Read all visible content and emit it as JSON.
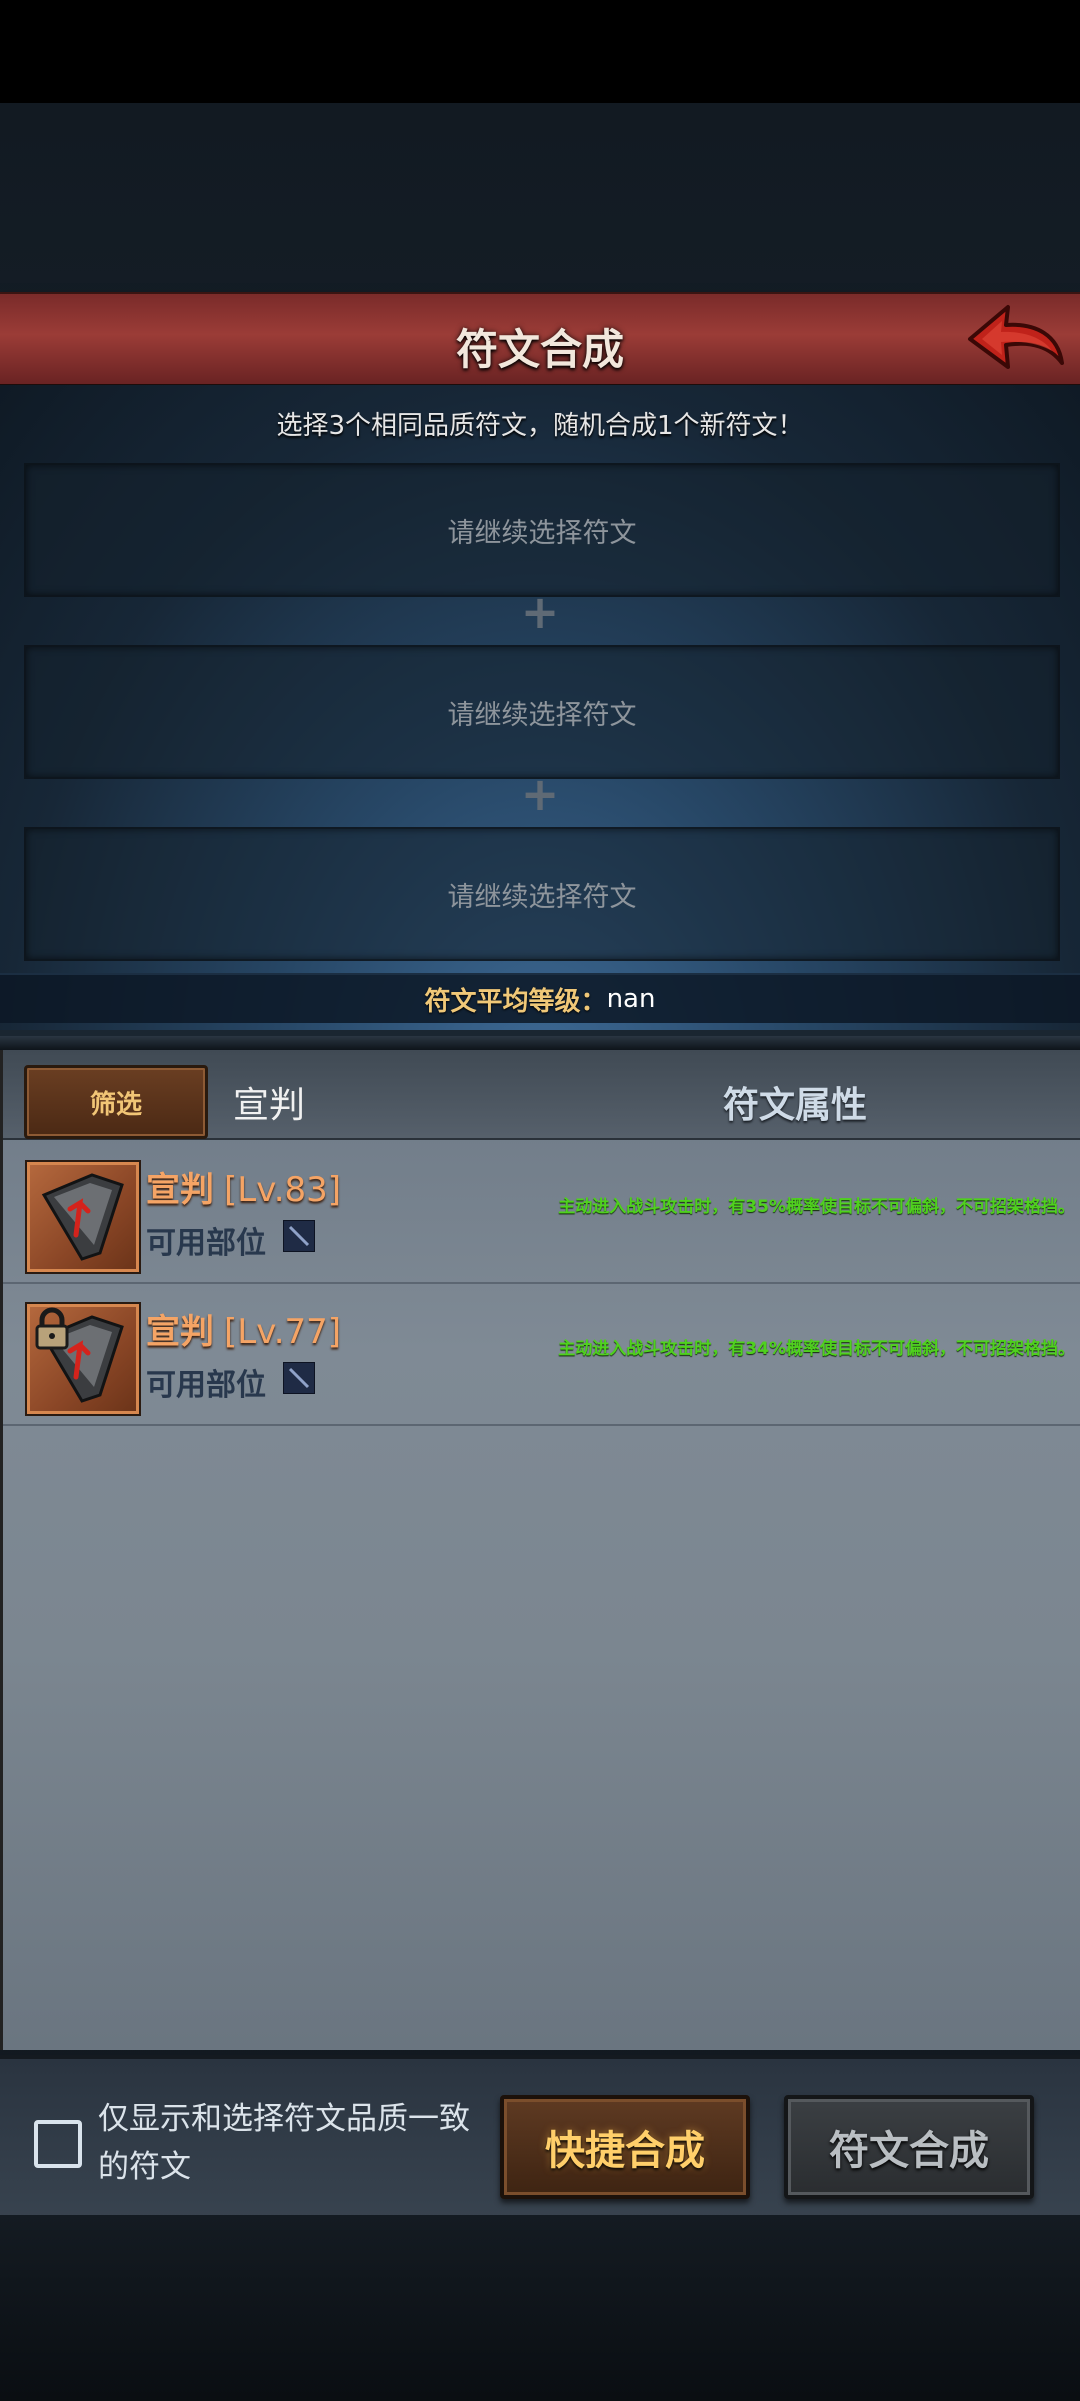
{
  "header": {
    "title": "符文合成"
  },
  "combine": {
    "instruction": "选择3个相同品质符文，随机合成1个新符文！",
    "slots": [
      {
        "placeholder": "请继续选择符文"
      },
      {
        "placeholder": "请继续选择符文"
      },
      {
        "placeholder": "请继续选择符文"
      }
    ],
    "plus_symbol": "+",
    "avg_level_label": "符文平均等级：",
    "avg_level_value": "nan"
  },
  "list": {
    "filter_label": "筛选",
    "filter_current": "宣判",
    "attributes_header": "符文属性",
    "slot_label": "可用部位",
    "items": [
      {
        "name": "宣判",
        "level": "[Lv.83]",
        "effect": "主动进入战斗攻击时，有35%概率使目标不可偏斜，不可招架格挡。",
        "locked": false
      },
      {
        "name": "宣判",
        "level": "[Lv.77]",
        "effect": "主动进入战斗攻击时，有34%概率使目标不可偏斜，不可招架格挡。",
        "locked": true
      }
    ]
  },
  "footer": {
    "checkbox_label": "仅显示和选择符文品质一致的符文",
    "quick_combine": "快捷合成",
    "combine": "符文合成"
  },
  "colors": {
    "title_bar": "#9b3c37",
    "rune_name": "#f5a465",
    "effect_text": "#4fd11e",
    "quick_button_text": "#ffcf6a"
  }
}
